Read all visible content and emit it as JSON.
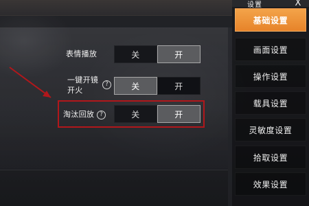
{
  "sidebar": {
    "title": "设置",
    "close_label": "X",
    "items": [
      {
        "label": "基础设置",
        "active": true
      },
      {
        "label": "画面设置",
        "active": false
      },
      {
        "label": "操作设置",
        "active": false
      },
      {
        "label": "载具设置",
        "active": false
      },
      {
        "label": "灵敏度设置",
        "active": false
      },
      {
        "label": "拾取设置",
        "active": false
      },
      {
        "label": "效果设置",
        "active": false
      }
    ]
  },
  "settings": {
    "emote_playback": {
      "label": "表情播放",
      "off": "关",
      "on": "开",
      "selected": "on"
    },
    "one_key_scope_fire": {
      "label_line1": "一键开镜",
      "label_line2": "开火",
      "off": "关",
      "on": "开",
      "selected": "off",
      "help": "?"
    },
    "elimination_replay": {
      "label": "淘汰回放",
      "off": "关",
      "on": "开",
      "selected": "on",
      "help": "?"
    }
  },
  "colors": {
    "accent_orange": "#e7832a",
    "highlight_red": "#b2171b"
  },
  "icons": {
    "close": "close-icon",
    "help": "help-icon"
  }
}
